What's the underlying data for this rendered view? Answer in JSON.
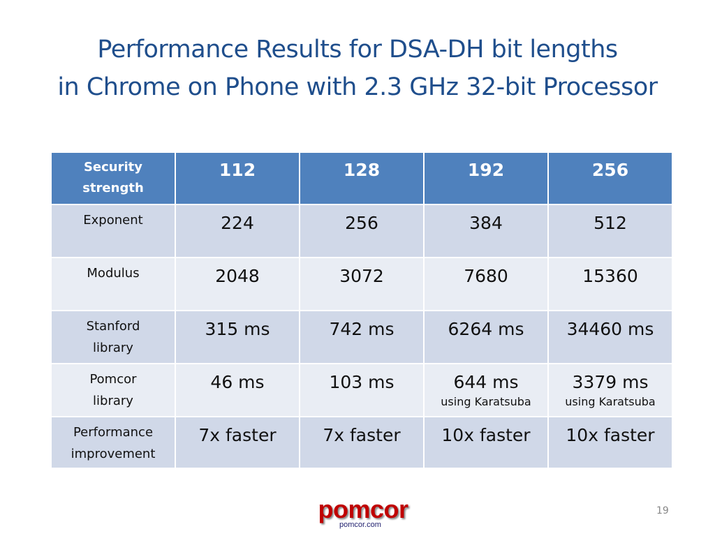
{
  "title": {
    "line1": "Performance Results for DSA-DH bit lengths",
    "line2": "in Chrome on Phone with 2.3 GHz 32-bit Processor"
  },
  "table": {
    "header": {
      "label": [
        "Security",
        "strength"
      ],
      "values": [
        "112",
        "128",
        "192",
        "256"
      ]
    },
    "rows": [
      {
        "label": [
          "Exponent"
        ],
        "values": [
          "224",
          "256",
          "384",
          "512"
        ],
        "subs": [
          "",
          "",
          "",
          ""
        ]
      },
      {
        "label": [
          "Modulus"
        ],
        "values": [
          "2048",
          "3072",
          "7680",
          "15360"
        ],
        "subs": [
          "",
          "",
          "",
          ""
        ]
      },
      {
        "label": [
          "Stanford",
          "library"
        ],
        "values": [
          "315 ms",
          "742 ms",
          "6264 ms",
          "34460 ms"
        ],
        "subs": [
          "",
          "",
          "",
          ""
        ]
      },
      {
        "label": [
          "Pomcor",
          "library"
        ],
        "values": [
          "46 ms",
          "103 ms",
          "644 ms",
          "3379 ms"
        ],
        "subs": [
          "",
          "",
          "using Karatsuba",
          "using Karatsuba"
        ]
      },
      {
        "label": [
          "Performance",
          "improvement"
        ],
        "values": [
          "7x faster",
          "7x faster",
          "10x faster",
          "10x faster"
        ],
        "subs": [
          "",
          "",
          "",
          ""
        ]
      }
    ]
  },
  "footer": {
    "logo": "pomcor",
    "logo_sub": "pomcor.com",
    "page_number": "19"
  },
  "colors": {
    "title": "#1f4e8c",
    "header_bg": "#4f81bd",
    "row_dark": "#d0d8e8",
    "row_light": "#e9edf4",
    "logo": "#c00000"
  }
}
